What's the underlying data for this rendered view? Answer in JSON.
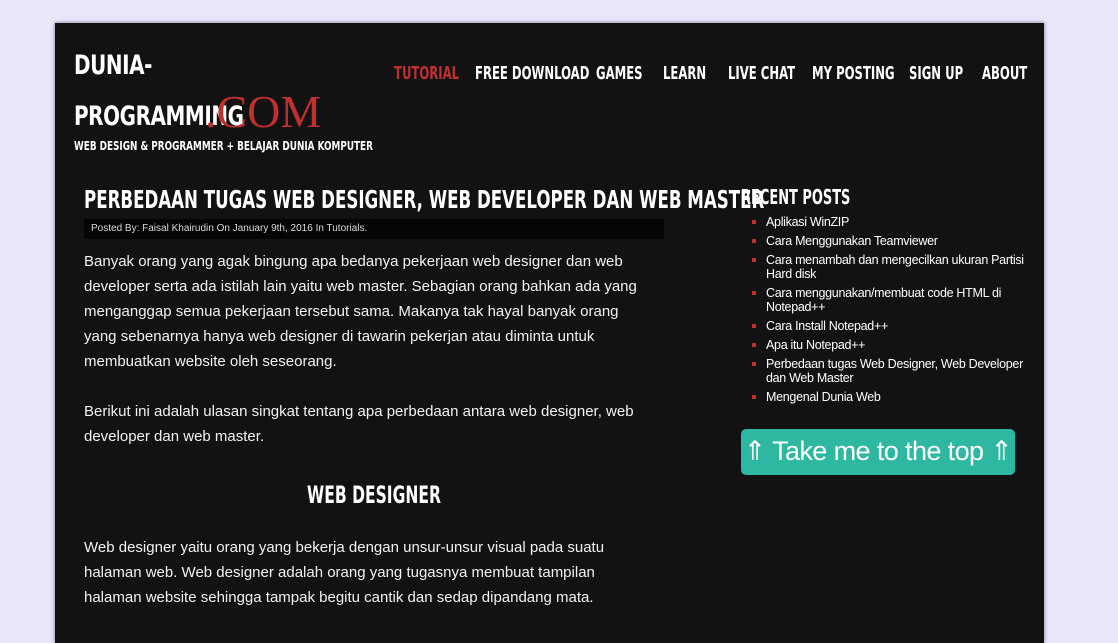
{
  "site": {
    "logo_line1": "DUNIA-",
    "logo_programming": "PROGRAMMING",
    "logo_com": ".COM",
    "tagline": "WEB DESIGN & PROGRAMMER + BELAJAR DUNIA KOMPUTER"
  },
  "nav": {
    "items": [
      {
        "label": "TUTORIAL",
        "active": true
      },
      {
        "label": "FREE DOWNLOAD",
        "active": false
      },
      {
        "label": "GAMES",
        "active": false
      },
      {
        "label": "LEARN",
        "active": false
      },
      {
        "label": "LIVE CHAT",
        "active": false
      },
      {
        "label": "MY POSTING",
        "active": false
      },
      {
        "label": "SIGN UP",
        "active": false
      },
      {
        "label": "ABOUT",
        "active": false
      }
    ]
  },
  "post": {
    "title": "PERBEDAAN TUGAS WEB DESIGNER, WEB DEVELOPER DAN WEB MASTER",
    "meta": "Posted By: Faisal Khairudin On January 9th, 2016 In Tutorials.",
    "paragraph1": "Banyak orang yang agak bingung apa bedanya pekerjaan web designer dan web developer serta ada istilah lain yaitu web master. Sebagian orang bahkan ada yang menganggap semua pekerjaan tersebut sama. Makanya tak hayal banyak orang yang sebenarnya hanya web designer di tawarin pekerjan atau diminta untuk membuatkan website oleh seseorang.",
    "paragraph2": "Berikut ini adalah ulasan singkat tentang apa perbedaan antara web designer, web developer dan web master.",
    "section_heading": "WEB DESIGNER",
    "paragraph3": "Web designer yaitu orang yang bekerja dengan unsur-unsur visual pada suatu halaman web. Web designer adalah orang yang tugasnya membuat tampilan halaman website sehingga tampak begitu cantik dan sedap dipandang mata."
  },
  "sidebar": {
    "title": "RECENT POSTS",
    "items": [
      "Aplikasi WinZIP",
      "Cara Menggunakan Teamviewer",
      "Cara menambah dan mengecilkan ukuran Partisi Hard disk",
      "Cara menggunakan/membuat code HTML di Notepad++",
      "Cara Install Notepad++",
      "Apa itu Notepad++",
      "Perbedaan tugas Web Designer, Web Developer dan Web Master",
      "Mengenal Dunia Web"
    ]
  },
  "top_button": {
    "label": "⇑ Take me to the top ⇑"
  },
  "colors": {
    "accent": "#c0302f",
    "button": "#2eb7a1",
    "page_bg": "#121213",
    "outer_bg": "#e9e8fb"
  }
}
